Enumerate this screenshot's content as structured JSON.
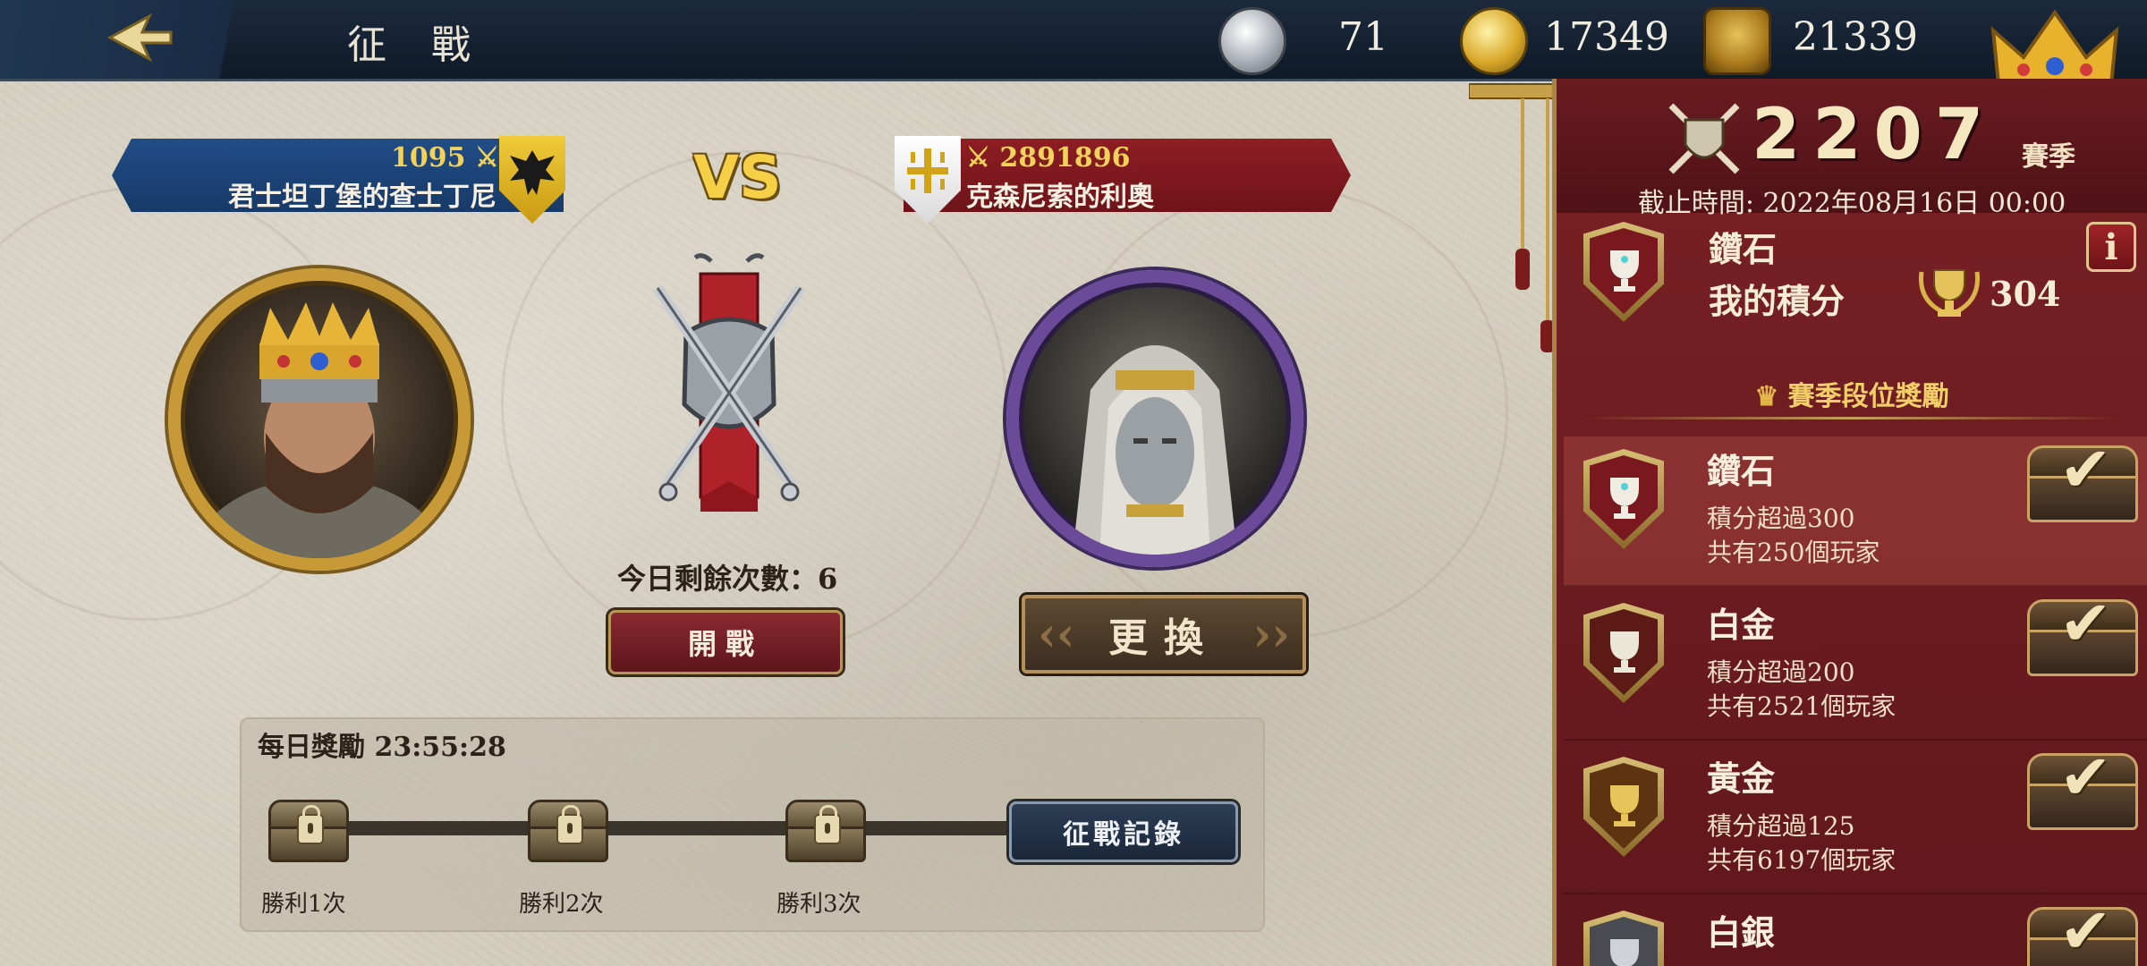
{
  "header": {
    "title": "征 戰",
    "silver": "71",
    "gold": "17349",
    "crowns": "21339"
  },
  "player": {
    "power": "1095",
    "name": "君士坦丁堡的查士丁尼"
  },
  "vs_label": "VS",
  "opponent": {
    "power": "2891896",
    "name": "克森尼索的利奧"
  },
  "battle": {
    "remaining": "今日剩餘次數：6",
    "start_label": "開戰",
    "change_label": "更換"
  },
  "daily_reward": {
    "title": "每日獎勵 23:55:28",
    "milestones": [
      "勝利1次",
      "勝利2次",
      "勝利3次"
    ],
    "record_label": "征戰記錄"
  },
  "season": {
    "points": "2207",
    "label": "賽季",
    "deadline": "截止時間: 2022年08月16日 00:00",
    "my_tier": "鑽石",
    "my_score_label": "我的積分",
    "my_score": "304",
    "info_label": "i",
    "rewards_title": "賽季段位獎勵",
    "tiers": [
      {
        "name": "鑽石",
        "req": "積分超過300",
        "count": "共有250個玩家",
        "color": "#8c1b22"
      },
      {
        "name": "白金",
        "req": "積分超過200",
        "count": "共有2521個玩家",
        "color": "#5c1a16"
      },
      {
        "name": "黃金",
        "req": "積分超過125",
        "count": "共有6197個玩家",
        "color": "#5e3410"
      },
      {
        "name": "白銀",
        "req": "",
        "count": "",
        "color": "#4a4a52"
      }
    ]
  },
  "colors": {
    "player_banner": "#1d4478",
    "opponent_banner": "#7d1a20",
    "season_panel": "#6e1c20",
    "gold_accent": "#f5cf45"
  },
  "icons": {
    "back": "back-arrow-icon",
    "silver": "silver-coin-icon",
    "gold": "gold-coin-icon",
    "crowns": "crown-badge-icon",
    "check": "check-icon"
  }
}
